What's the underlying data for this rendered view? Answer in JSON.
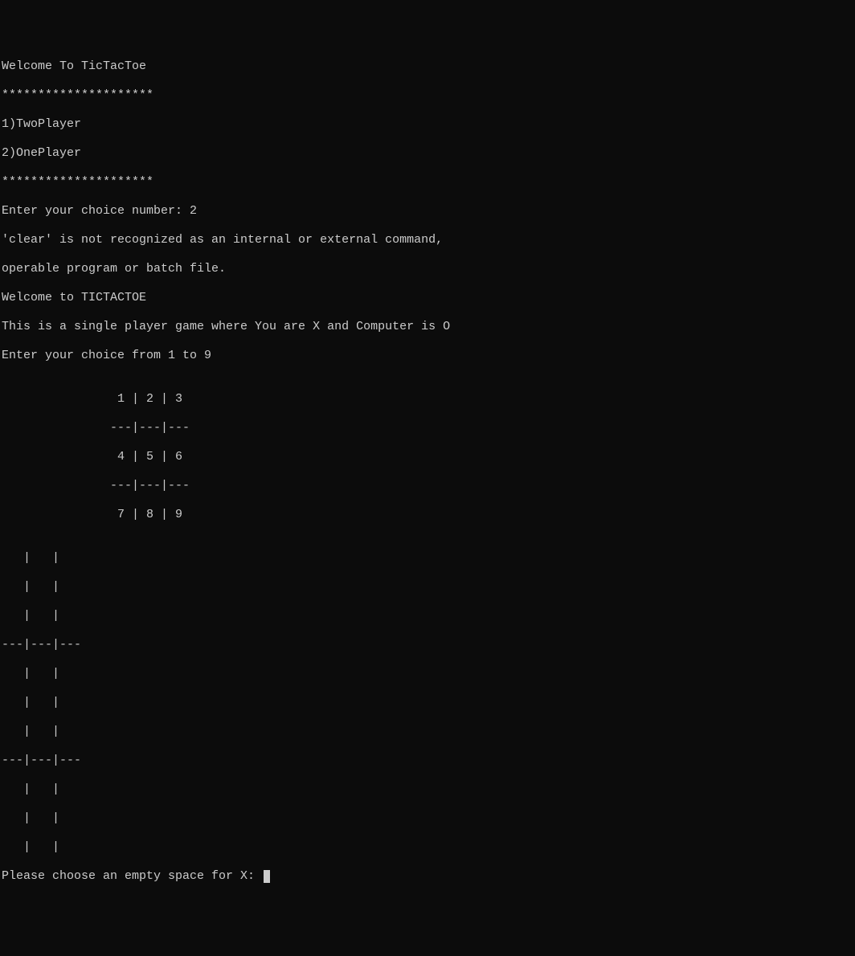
{
  "lines": {
    "welcome": "Welcome To TicTacToe",
    "stars1": "*********************",
    "option1": "1)TwoPlayer",
    "option2": "2)OnePlayer",
    "stars2": "*********************",
    "enterChoice": "Enter your choice number: 2",
    "clearError1": "'clear' is not recognized as an internal or external command,",
    "clearError2": "operable program or batch file.",
    "welcome2": "Welcome to TICTACTOE",
    "gameDesc": "This is a single player game where You are X and Computer is O",
    "chooseFrom": "Enter your choice from 1 to 9",
    "blank1": "",
    "gridRow1": "                1 | 2 | 3",
    "gridDiv1": "               ---|---|---",
    "gridRow2": "                4 | 5 | 6",
    "gridDiv2": "               ---|---|---",
    "gridRow3": "                7 | 8 | 9",
    "blank2": "",
    "board1": "   |   |  ",
    "board2": "   |   |  ",
    "board3": "   |   |  ",
    "boardDiv1": "---|---|---",
    "board4": "   |   |  ",
    "board5": "   |   |  ",
    "board6": "   |   |  ",
    "boardDiv2": "---|---|---",
    "board7": "   |   |  ",
    "board8": "   |   |  ",
    "board9": "   |   |  ",
    "prompt": "Please choose an empty space for X: "
  }
}
